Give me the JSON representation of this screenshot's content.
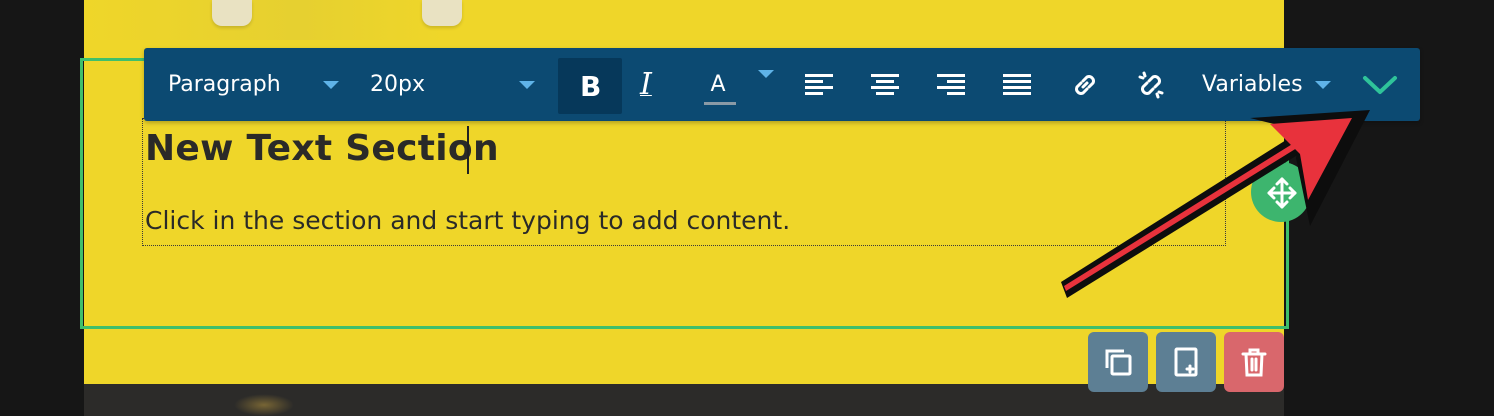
{
  "toolbar": {
    "block_format": "Paragraph",
    "font_size": "20px",
    "bold_label": "B",
    "italic_label": "I",
    "text_color_label": "A",
    "variables_label": "Variables"
  },
  "content": {
    "heading": "New Text Section",
    "paragraph": "Click in the section and start typing to add content."
  },
  "colors": {
    "canvas_background": "#efd629",
    "toolbar_background": "#0c4a72",
    "selection_border": "#3fbf6b",
    "collapse_chevron": "#2fc39a",
    "delete_button": "#d9676c",
    "action_buttons": "#5d7f94",
    "annotation_arrow": "#e8323c"
  },
  "icons": {
    "dropdown": "caret-down-icon",
    "align": [
      "align-left-icon",
      "align-center-icon",
      "align-right-icon",
      "align-justify-icon"
    ],
    "links": [
      "link-icon",
      "unlink-icon"
    ],
    "collapse": "chevron-down-icon",
    "move": "move-icon",
    "actions": [
      "duplicate-icon",
      "add-page-icon",
      "trash-icon"
    ]
  }
}
